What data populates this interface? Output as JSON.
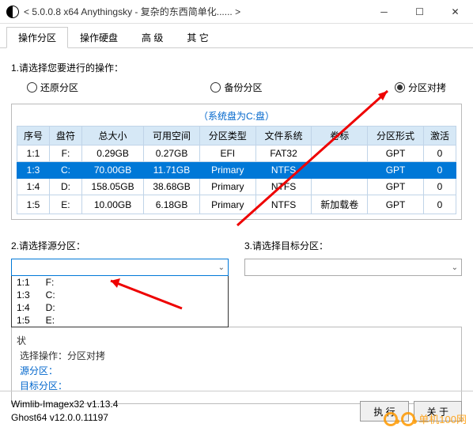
{
  "window": {
    "title": "< 5.0.0.8 x64 Anythingsky - 复杂的东西简单化...... >"
  },
  "tabs": [
    "操作分区",
    "操作硬盘",
    "高 级",
    "其 它"
  ],
  "step1": {
    "label": "1.请选择您要进行的操作：",
    "options": {
      "restore": "还原分区",
      "backup": "备份分区",
      "clone": "分区对拷"
    }
  },
  "sysDisk": "（系统盘为C:盘）",
  "table": {
    "headers": [
      "序号",
      "盘符",
      "总大小",
      "可用空间",
      "分区类型",
      "文件系统",
      "卷标",
      "分区形式",
      "激活"
    ],
    "rows": [
      {
        "cells": [
          "1:1",
          "F:",
          "0.29GB",
          "0.27GB",
          "EFI",
          "FAT32",
          "",
          "GPT",
          "0"
        ],
        "selected": false
      },
      {
        "cells": [
          "1:3",
          "C:",
          "70.00GB",
          "11.71GB",
          "Primary",
          "NTFS",
          "",
          "GPT",
          "0"
        ],
        "selected": true
      },
      {
        "cells": [
          "1:4",
          "D:",
          "158.05GB",
          "38.68GB",
          "Primary",
          "NTFS",
          "",
          "GPT",
          "0"
        ],
        "selected": false
      },
      {
        "cells": [
          "1:5",
          "E:",
          "10.00GB",
          "6.18GB",
          "Primary",
          "NTFS",
          "新加载卷",
          "GPT",
          "0"
        ],
        "selected": false
      }
    ]
  },
  "step2": {
    "label": "2.请选择源分区："
  },
  "step3": {
    "label": "3.请选择目标分区："
  },
  "sourceList": [
    "1:1      F:",
    "1:3      C:",
    "1:4      D:",
    "1:5      E:"
  ],
  "status": {
    "op": "选择操作：分区对拷",
    "src": "源分区：",
    "dst": "目标分区："
  },
  "footer": {
    "v1": "Wimlib-Imagex32 v1.13.4",
    "v2": "Ghost64 v12.0.0.11197",
    "exec": "执 行",
    "about": "关 于"
  },
  "watermark": "单机100网"
}
